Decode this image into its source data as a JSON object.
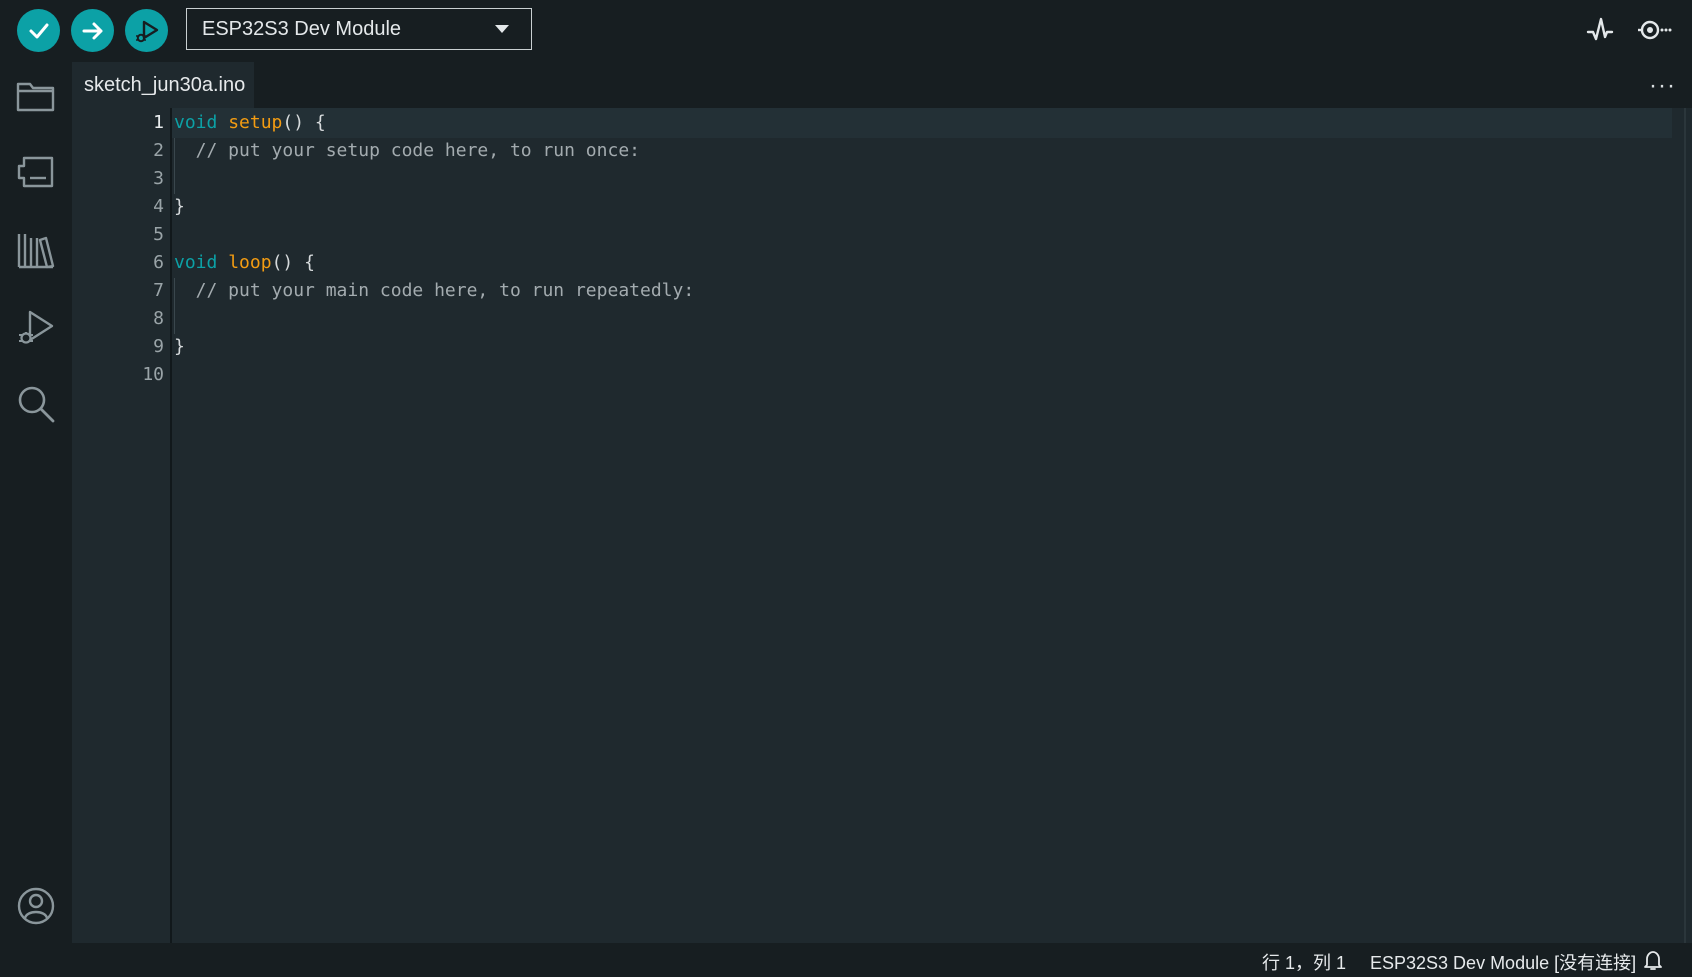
{
  "toolbar": {
    "verify_icon": "check-icon",
    "upload_icon": "arrow-right-icon",
    "debug_icon": "debug-icon",
    "board_select": "ESP32S3 Dev Module",
    "serial_plotter_icon": "plotter-icon",
    "serial_monitor_icon": "serial-monitor-icon",
    "accent": "#0ca1a6"
  },
  "sidebar": {
    "items": [
      {
        "icon": "folder-icon"
      },
      {
        "icon": "board-manager-icon"
      },
      {
        "icon": "library-icon"
      },
      {
        "icon": "debug-icon"
      },
      {
        "icon": "search-icon"
      }
    ],
    "account_icon": "account-icon"
  },
  "tabs": [
    {
      "label": "sketch_jun30a.ino"
    }
  ],
  "tab_more": "···",
  "editor": {
    "line_numbers": [
      "1",
      "2",
      "3",
      "4",
      "5",
      "6",
      "7",
      "8",
      "9",
      "10"
    ],
    "lines": [
      {
        "kw": "void",
        "fn": "setup",
        "rest": "() {"
      },
      {
        "comment": "  // put your setup code here, to run once:"
      },
      {
        "text": ""
      },
      {
        "text": "}"
      },
      {
        "text": ""
      },
      {
        "kw": "void",
        "fn": "loop",
        "rest": "() {"
      },
      {
        "comment": "  // put your main code here, to run repeatedly:"
      },
      {
        "text": ""
      },
      {
        "text": "}"
      },
      {
        "text": ""
      }
    ],
    "keyword_color": "#0ca1a6",
    "function_color": "#f39c12"
  },
  "status": {
    "position": "行 1，列 1",
    "board": "ESP32S3 Dev Module [没有连接]",
    "bell_icon": "bell-icon"
  }
}
